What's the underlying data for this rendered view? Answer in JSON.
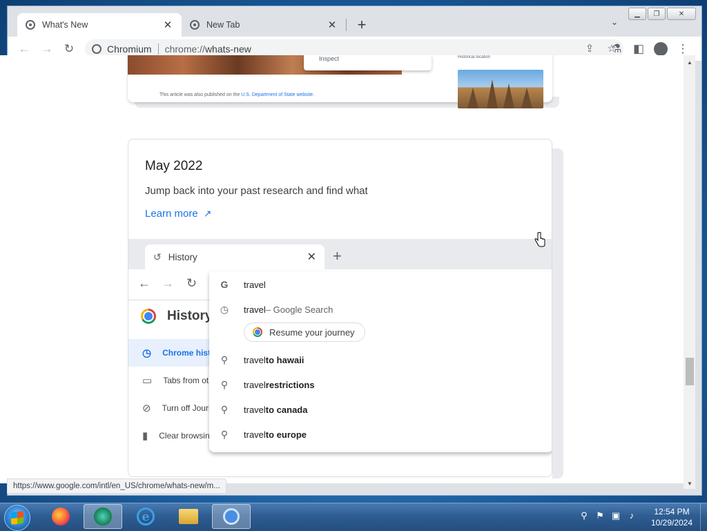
{
  "window": {
    "minimize_icon": "minimize-icon",
    "maximize_icon": "restore-icon",
    "close_icon": "close-icon"
  },
  "tabs": [
    {
      "title": "What's New",
      "active": true
    },
    {
      "title": "New Tab",
      "active": false
    }
  ],
  "toolbar": {
    "site_name": "Chromium",
    "url_scheme": "chrome://",
    "url_path": "whats-new"
  },
  "article": {
    "inspect_label": "Inspect",
    "note_prefix": "This article was also published on the ",
    "note_link": "U.S. Department of State website",
    "note_suffix": ".",
    "thumb_caption": "Historical location"
  },
  "card": {
    "date": "May 2022",
    "description": "Jump back into your past research and find what",
    "link_label": "Learn more",
    "link_arrow": "↗"
  },
  "screenshot": {
    "tab_title": "History",
    "history_title": "History",
    "side_items": [
      {
        "label": "Chrome history",
        "icon": "clock-icon",
        "selected": true
      },
      {
        "label": "Tabs from other devices",
        "icon": "devices-icon",
        "selected": false
      },
      {
        "label": "Turn off Journeys",
        "icon": "journeys-off-icon",
        "selected": false
      },
      {
        "label": "Clear browsing data",
        "icon": "trash-icon",
        "selected": false
      }
    ],
    "dropdown": {
      "query": "travel",
      "search_prefix": "travel",
      "search_suffix": " – Google Search",
      "chip_label": "Resume your journey",
      "suggestions": [
        {
          "prefix": "travel",
          "bold": " to hawaii"
        },
        {
          "prefix": "travel",
          "bold": " restrictions"
        },
        {
          "prefix": "travel",
          "bold": " to canada"
        },
        {
          "prefix": "travel",
          "bold": " to europe"
        }
      ]
    }
  },
  "status_url": "https://www.google.com/intl/en_US/chrome/whats-new/m...",
  "taskbar": {
    "time": "12:54 PM",
    "date": "10/29/2024",
    "apps": [
      "firefox",
      "edge",
      "internet-explorer",
      "file-explorer",
      "chromium"
    ]
  },
  "colors": {
    "accent": "#1a73e8",
    "tab_strip": "#dee1e6",
    "taskbar": "#2f5d92"
  }
}
